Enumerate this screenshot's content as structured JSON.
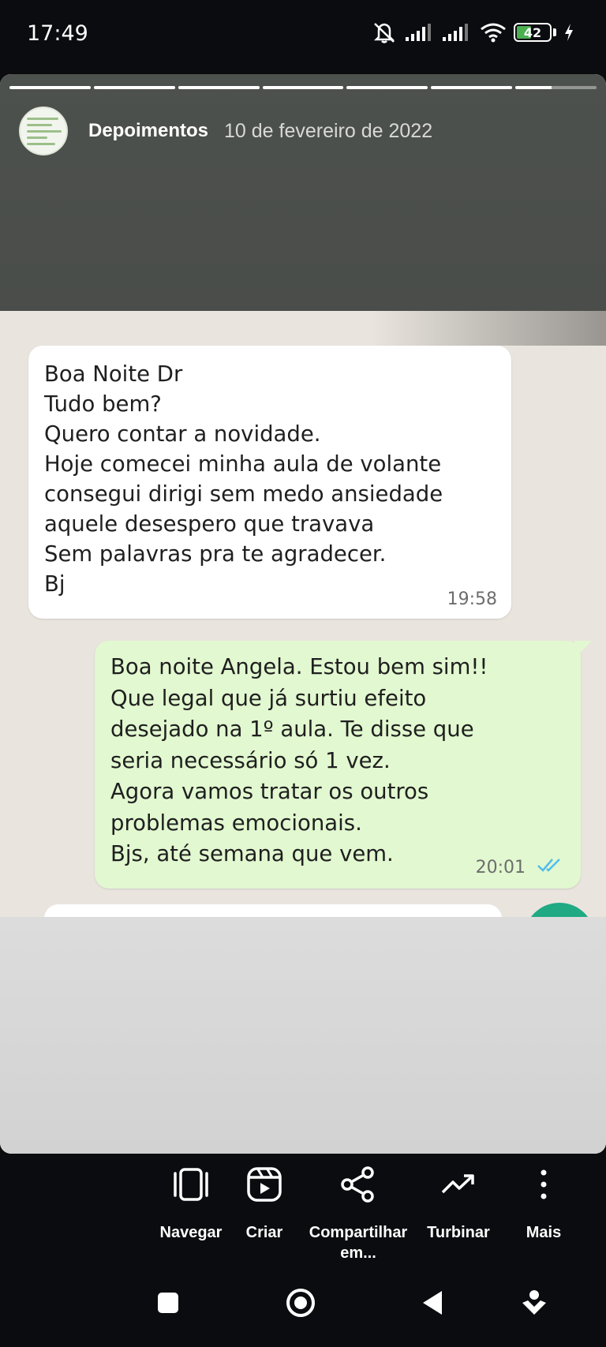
{
  "status_bar": {
    "time": "17:49",
    "battery_level": "42",
    "icons": [
      "mute-icon",
      "signal-icon",
      "signal-icon",
      "wifi-icon",
      "battery-icon",
      "charging-icon"
    ]
  },
  "story": {
    "title": "Depoimentos",
    "date": "10 de fevereiro de 2022",
    "segments": 7,
    "current_segment": 7
  },
  "chat": {
    "incoming": {
      "text": "Boa Noite Dr\nTudo bem?\nQuero contar a novidade.\nHoje comecei minha aula de volante\nconsegui dirigi sem medo ansiedade\naquele desespero que travava\nSem palavras pra te agradecer.\nBj",
      "time": "19:58"
    },
    "outgoing": {
      "text": "Boa noite Angela. Estou bem sim!!\nQue legal que já surtiu efeito\ndesejado na 1º aula. Te disse que\nseria necessário só 1 vez.\nAgora vamos tratar os outros\nproblemas emocionais.\nBjs, até semana que vem.",
      "time": "20:01",
      "status": "read"
    },
    "colors": {
      "incoming_bg": "#ffffff",
      "outgoing_bg": "#e2f8d0",
      "read_tick": "#53bdeb"
    }
  },
  "actions": [
    {
      "label": "Navegar",
      "icon": "navigate-icon"
    },
    {
      "label": "Criar",
      "icon": "create-reel-icon"
    },
    {
      "label": "Compartilhar\nem...",
      "icon": "share-icon"
    },
    {
      "label": "Turbinar",
      "icon": "boost-icon"
    },
    {
      "label": "Mais",
      "icon": "more-icon"
    }
  ],
  "nav": [
    "recents-icon",
    "home-icon",
    "back-icon",
    "assistant-icon"
  ]
}
